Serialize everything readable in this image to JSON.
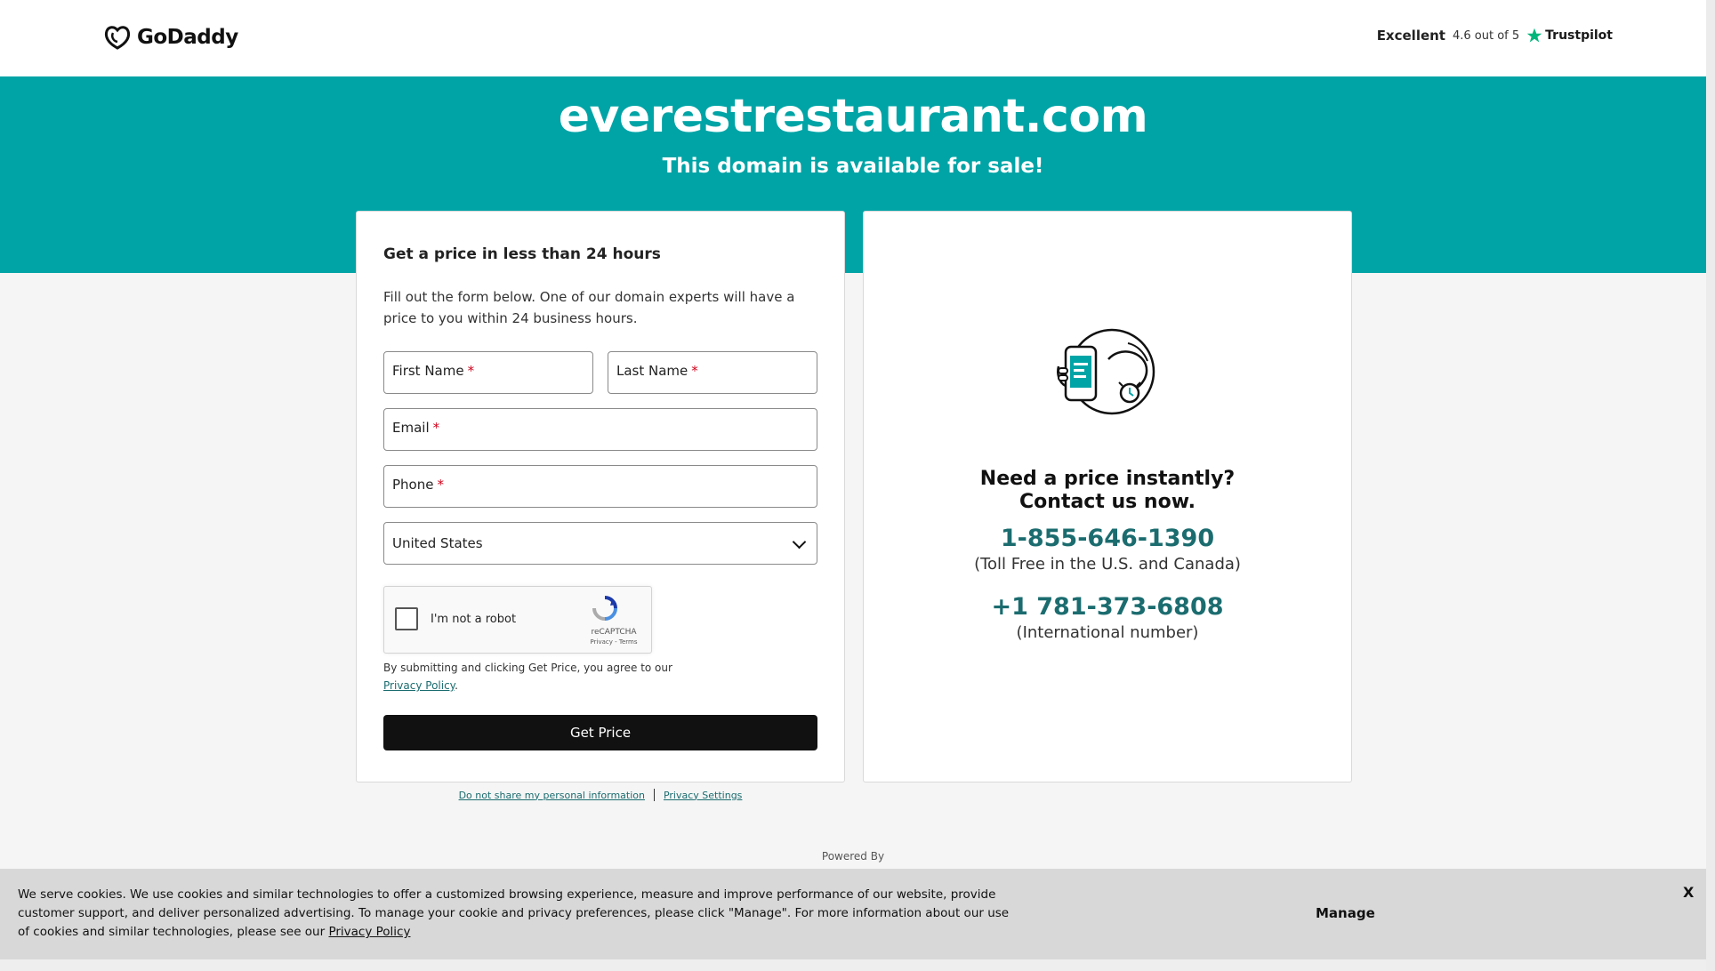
{
  "header": {
    "logo_text": "GoDaddy",
    "trustpilot": {
      "label": "Excellent",
      "rating": "4.6 out of 5",
      "brand": "Trustpilot"
    }
  },
  "hero": {
    "domain": "everestrestaurant.com",
    "subtitle": "This domain is available for sale!"
  },
  "form": {
    "heading": "Get a price in less than 24 hours",
    "description": "Fill out the form below. One of our domain experts will have a price to you within 24 business hours.",
    "fields": {
      "first_name": "First Name",
      "last_name": "Last Name",
      "email": "Email",
      "phone": "Phone",
      "country": "United States",
      "required_marker": "*"
    },
    "captcha": {
      "label": "I'm not a robot",
      "brand": "reCAPTCHA",
      "links": "Privacy - Terms"
    },
    "consent_text": "By submitting and clicking Get Price, you agree to our",
    "consent_link": "Privacy Policy",
    "consent_end": ".",
    "submit_label": "Get Price"
  },
  "contact": {
    "heading_line1": "Need a price instantly?",
    "heading_line2": "Contact us now.",
    "phone_tollfree": "1-855-646-1390",
    "tollfree_note": "(Toll Free in the U.S. and Canada)",
    "phone_international": "+1 781-373-6808",
    "international_note": "(International number)"
  },
  "footer_links": {
    "do_not_share": "Do not share my personal information",
    "privacy_settings": "Privacy Settings"
  },
  "powered_by": "Powered By",
  "cookie_banner": {
    "text": "We serve cookies. We use cookies and similar technologies to offer a customized browsing experience, measure and improve performance of our website, provide customer support, and deliver personalized advertising. To manage your cookie and privacy preferences, please click \"Manage\". For more information about our use of cookies and similar technologies, please see our",
    "link": "Privacy Policy",
    "manage_label": "Manage",
    "close_label": "X"
  },
  "colors": {
    "brand_teal": "#00a4a6",
    "link_teal": "#1b6c6f",
    "button_black": "#111111",
    "trustpilot_green": "#00b67a"
  }
}
